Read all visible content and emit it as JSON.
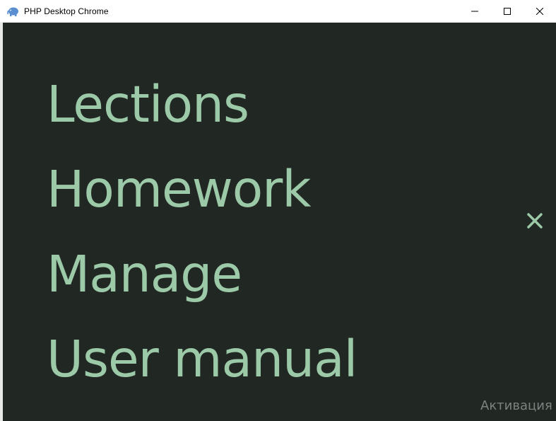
{
  "window": {
    "title": "PHP Desktop Chrome",
    "icon": "php-elephant-icon",
    "controls": {
      "minimize": "minimize-icon",
      "maximize": "maximize-icon",
      "close": "close-icon"
    }
  },
  "menu": {
    "items": [
      {
        "label": "Lections"
      },
      {
        "label": "Homework"
      },
      {
        "label": "Manage"
      },
      {
        "label": "User manual"
      }
    ],
    "close_icon": "close-x-icon"
  },
  "overlay": {
    "activation_text": "Активация W"
  },
  "colors": {
    "background": "#212824",
    "menu_text": "#9cc9a7",
    "titlebar": "#ffffff",
    "watermark": "#7d8280"
  }
}
